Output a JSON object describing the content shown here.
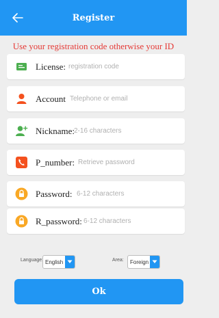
{
  "colors": {
    "accent": "#2196f3",
    "notice": "#e53935",
    "background": "#eeeeee"
  },
  "header": {
    "back_icon": "back-arrow-icon",
    "title": "Register"
  },
  "notice": "Use your registration code otherwise your ID",
  "form": {
    "license": {
      "icon": "license-icon",
      "icon_color": "#4caf50",
      "label": "License:",
      "placeholder": "registration code"
    },
    "account": {
      "icon": "person-icon",
      "icon_color": "#f4511e",
      "label": "Account",
      "placeholder": "Telephone or email"
    },
    "nickname": {
      "icon": "add-user-icon",
      "icon_color": "#4caf50",
      "label": "Nickname:",
      "placeholder": "2-16 characters"
    },
    "p_number": {
      "icon": "phone-icon",
      "icon_color": "#f4511e",
      "label": "P_number:",
      "placeholder": "Retrieve password"
    },
    "password": {
      "icon": "lock-icon",
      "icon_color": "#f9a825",
      "label": "Password:",
      "placeholder": "6-12 characters"
    },
    "r_password": {
      "icon": "lock-icon",
      "icon_color": "#f9a825",
      "label": "R_password:",
      "placeholder": "6-12 characters"
    }
  },
  "options": {
    "language": {
      "label": "Language:",
      "value": "English",
      "icon": "chevron-down-icon"
    },
    "area": {
      "label": "Area:",
      "value": "Foreign",
      "icon": "chevron-down-icon"
    }
  },
  "ok_label": "Ok"
}
